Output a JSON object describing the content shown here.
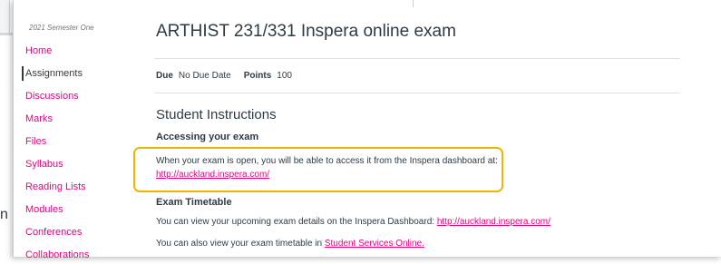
{
  "background": {
    "fragment_text": "n"
  },
  "sidebar": {
    "term": "2021 Semester One",
    "items": [
      {
        "label": "Home",
        "active": false
      },
      {
        "label": "Assignments",
        "active": true
      },
      {
        "label": "Discussions",
        "active": false
      },
      {
        "label": "Marks",
        "active": false
      },
      {
        "label": "Files",
        "active": false
      },
      {
        "label": "Syllabus",
        "active": false
      },
      {
        "label": "Reading Lists",
        "active": false
      },
      {
        "label": "Modules",
        "active": false
      },
      {
        "label": "Conferences",
        "active": false
      },
      {
        "label": "Collaborations",
        "active": false
      }
    ]
  },
  "assignment": {
    "title": "ARTHIST 231/331 Inspera online exam",
    "due_label": "Due",
    "due_value": "No Due Date",
    "points_label": "Points",
    "points_value": "100"
  },
  "instructions": {
    "heading": "Student Instructions",
    "accessing": {
      "heading": "Accessing your exam",
      "text": "When your exam is open, you will be able to access it from the Inspera dashboard at:",
      "link": "http://auckland.inspera.com/"
    },
    "timetable": {
      "heading": "Exam Timetable",
      "line1_text": "You can view your upcoming exam details on the Inspera Dashboard: ",
      "line1_link": "http://auckland.inspera.com/",
      "line2_text": "You can also view your exam timetable in ",
      "line2_link": "Student Services Online."
    }
  },
  "colors": {
    "link": "#e6007e",
    "highlight": "#f0b400",
    "text": "#2d3b45"
  }
}
